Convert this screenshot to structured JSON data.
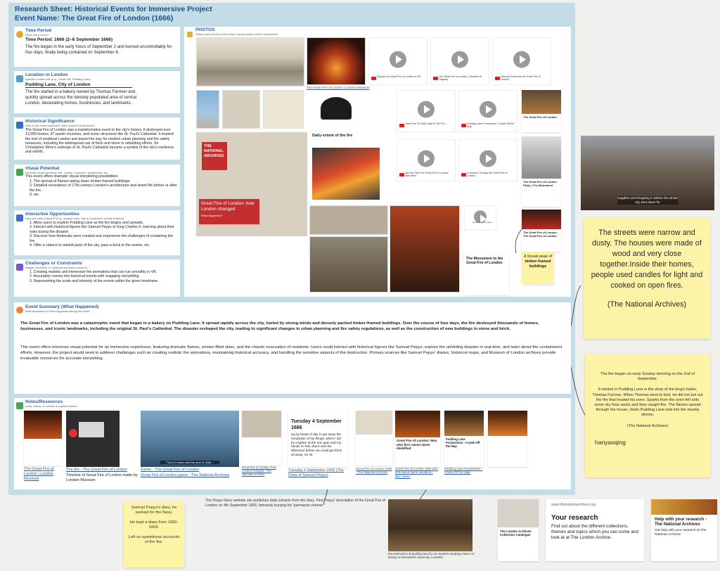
{
  "header": {
    "title": "Research Sheet: Historical Events for Immersive Project",
    "event_name": "Event Name: The Great Fire of London (1666)"
  },
  "time_period": {
    "heading": "Time Period",
    "sub": "When did it occur?",
    "label": "Time Period: 1666 (2–6 September 1666)",
    "body": "The fire began in the early hours of September 2 and burned uncontrollably for four days, finally being contained on September 6."
  },
  "location": {
    "heading": "Location in London",
    "sub": "Specific London site (e.g., Tower Hill, Pudding Lane)",
    "label": "Pudding Lane, City of London",
    "body": "The fire started in a bakery owned by Thomas Farriner and quickly spread across the densely populated area of central London, devastating homes, businesses, and landmarks."
  },
  "significance": {
    "heading": "Historical Significance",
    "sub": "Why is this event important? Why should it be featured?",
    "body": "The Great Fire of London was a transformative event in the city's history. It destroyed over 13,000 homes, 87 parish churches, and iconic structures like St. Paul's Cathedral. It marked the end of medieval London and paved the way for modern urban planning and fire safety measures, including the widespread use of brick and stone in rebuilding efforts. Sir Christopher Wren's redesign of St. Paul's Cathedral became a symbol of the city's resilience and rebirth."
  },
  "visual": {
    "heading": "Visual Potential",
    "sub": "Describe visual elements: fire, crowds, costumes, architecture, etc.",
    "intro": "This event offers dramatic visual storytelling possibilities:",
    "items": [
      "1. The spread of flames taking down timber-framed buildings.",
      "2. Detailed recreations of 17th-century London's architecture and street life before or after the fire.",
      "3. etc."
    ]
  },
  "interactive": {
    "heading": "Interactive Opportunities",
    "sub": "How can users interact? (e.g., explore ruins, talk to characters, handle artifacts)",
    "items": [
      "1. Allow users to explore Pudding Lane as the fire begins and spreads.",
      "2. Interact with historical figures like Samuel Pepys or King Charles II, learning about their roles during the disaster.",
      "3. Discover how firebreaks were created and experience the challenges of containing the fire.",
      "4. Offer a chance to rebuild parts of the city, pass a brick to the worker, etc."
    ]
  },
  "challenges": {
    "heading": "Challenges or Constraints",
    "sub": "Budget, technical, or historical accuracy concerns",
    "items": [
      "1. Creating realistic and immersive fire animations that can run smoothly in VR.",
      "2. Accurately convey this historical events with engaging storytelling.",
      "3. Representing the scale and intensity of the events within the given timeframe."
    ]
  },
  "photos": {
    "heading": "PHOTOS",
    "sub": "Share some photos of the shop / service point/ service experience",
    "museum_link": "The Great Fire of London | London Museum",
    "na_title": "THE NATIONAL ARCHIVES",
    "na_headline": "Great Fire of London: how London changed",
    "na_sub": "What happened?",
    "map_title": "Daily extent of the fire",
    "monument_title": "The Monument to the Great Fire of London",
    "lfb_title": "The Great Fire of London",
    "na_card_title": "The Great Fire of London FAQs | The Monument",
    "lfb2_title": "The Great Fire of London - The Great Fire of London"
  },
  "videos": [
    {
      "caption": "Explore the Great Fire of London in VR"
    },
    {
      "caption": "The Great Fire of London | Timeline of Tragedy"
    },
    {
      "caption": "How did it become the Great Fire of London"
    },
    {
      "caption": "Great Fire Of 1666: Map In The Pre-...."
    },
    {
      "caption": "Pudding Lane Productions - Crytek Off the Map"
    },
    {
      "caption": "Did You Find The Great Fire of London Start Here"
    },
    {
      "caption": "A Journey Through the Great Fire of London"
    },
    {
      "caption": "Great Fire of London"
    }
  ],
  "sneak_note": {
    "text": "A Sneak peak of",
    "bold": "timber-framed buildings"
  },
  "video_still_caption": "supplies and shopping in before the whole city shut down for",
  "note_streets": {
    "text": "The streets were narrow and dusty.  The houses were made of wood and very close together.Inside their homes, people used candles for light and cooked on open fires.",
    "source": "(The National Archives)"
  },
  "note_fire": {
    "p1": "The fire began on early Sunday morning on the 2nd of September.",
    "p2": "It started in Pudding Lane in the shop of the king's baker, Thomas Farriner. When Thomas went to bed, he did not put out the fire that heated his oven. Sparks from the oven fell onto some dry flour sacks and they caught fire. The flames spread through the house, down Pudding Lane and into the nearby streets.",
    "source": "(The National Archives)",
    "author": "hanyaoqing"
  },
  "summary": {
    "heading": "Event Summary (What Happened)",
    "sub": "Brief description of what happened during the event",
    "bold": "The Great Fire of London was a catastrophic event that began in a bakery on Pudding Lane. It spread rapidly across the city, fueled by strong winds and densely packed timber-framed buildings. Over the course of four days, the fire destroyed thousands of homes, businesses, and iconic landmarks, including the original St. Paul's Cathedral. The disaster reshaped the city, leading to significant changes in urban planning and fire safety regulations, as well as the construction of new buildings in stone and brick.",
    "body": "This event offers immense visual potential for an immersive experience, featuring dramatic flames, smoke-filled skies, and the chaotic evacuation of residents. Users could interact with historical figures like Samuel Pepys, explore the unfolding disaster in real-time, and learn about the containment efforts. However, the project would need to address challenges such as creating realistic fire animations, maintaining historical accuracy, and handling the sensitive aspects of the destruction. Primary sources like Samuel Pepys' diaries, historical maps, and Museum of London archives provide invaluable resources for accurate storytelling."
  },
  "notes": {
    "heading": "Notes/Resources",
    "sub": "Links, books, or articles to explore further",
    "links": [
      "The Great Fire of London | London Museum",
      "The fire - The Great Fire of London",
      "Game - The Great Fire of London",
      "Great Fire of London: how London changed - The National Archives",
      "Tuesday 4 September 1666 (The Diary of Samuel Pepys)",
      "Great Fire of London 1666 - The National Archives",
      "Great Fire of London: Man who first raised alarm identified - BBC News",
      "Pudding Lane Productions - Crytek Off the Map"
    ],
    "timeline_text": "Timeline of Great Fire of Lonfon made by London Museum",
    "game_link": "Great Fire of London game - The National Archives",
    "game_caption": "This is London and the year is 1666...",
    "pepys_title": "Tuesday 4 September 1666",
    "pepys_body": "Up by break of day to get away the remainder of my things; which I did by a lighter at the Iron gate and my hands so few, that it was the afternoon before we could get them all away. Sir W.",
    "bbc_title": "Great Fire of London: Man who first raised alarm identified",
    "pudding_title": "Pudding Lane Productions - Crytek Off the Map"
  },
  "pepys_note": {
    "l1": "Samuel Pepys's diary, he worked for the Navy.",
    "l2": "He kept a diary from 1660-1669.",
    "l3": "Left us eyewitness accounts of the fire."
  },
  "pepys_site_caption": "The Pepys Diary website site publishes daily extracts from the diary. Find Pepys' description of the Great Fire of London on 4th September 1666, famously burying his 'parmazan cheese'.",
  "reconstruction_caption": "Reconstruction of pudding land by six students studying Game Art Design at DeMontfort University, Leicester",
  "collections_card": {
    "title": "The London Archives Collection Catalogue"
  },
  "research_card": {
    "site": "www.thelondonarchives.org",
    "title": "Your research",
    "body": "Find out about the different collections, themes and topics which you can come and look at at The London Archive"
  },
  "help_card": {
    "title": "Help with your research - The National Archives",
    "body": "Get help with your research at The National Archives"
  },
  "colors": {
    "accent": "#2a5ca8",
    "frame": "#c3dde6",
    "sticky": "#fdf3a7"
  }
}
